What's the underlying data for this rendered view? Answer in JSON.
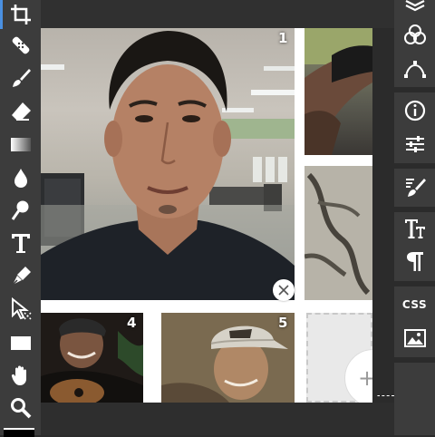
{
  "left_toolbar": {
    "tools": [
      {
        "name": "crop-icon",
        "active": true
      },
      {
        "name": "healing-brush-icon"
      },
      {
        "name": "brush-icon"
      },
      {
        "name": "eraser-icon"
      },
      {
        "name": "gradient-icon"
      },
      {
        "name": "blur-drop-icon"
      },
      {
        "name": "dodge-icon"
      },
      {
        "name": "type-icon"
      },
      {
        "name": "pen-icon"
      },
      {
        "name": "path-select-icon"
      },
      {
        "name": "rectangle-icon"
      },
      {
        "name": "hand-icon"
      },
      {
        "name": "zoom-icon"
      }
    ],
    "foreground_color": "#000000",
    "accent": "#4a90e2"
  },
  "right_toolbar": {
    "items": [
      {
        "name": "layers-icon"
      },
      {
        "name": "channels-icon"
      },
      {
        "name": "paths-icon"
      },
      {
        "name": "info-icon"
      },
      {
        "name": "adjustments-icon"
      },
      {
        "name": "brush-settings-icon"
      },
      {
        "name": "character-icon"
      },
      {
        "name": "paragraph-icon"
      },
      {
        "name": "css-icon",
        "label": "CSS"
      },
      {
        "name": "image-icon"
      }
    ]
  },
  "canvas": {
    "tiles": [
      {
        "number": "1"
      },
      {
        "number": "4"
      },
      {
        "number": "5"
      }
    ],
    "add_symbol": "+",
    "remove_symbol": "✕"
  }
}
